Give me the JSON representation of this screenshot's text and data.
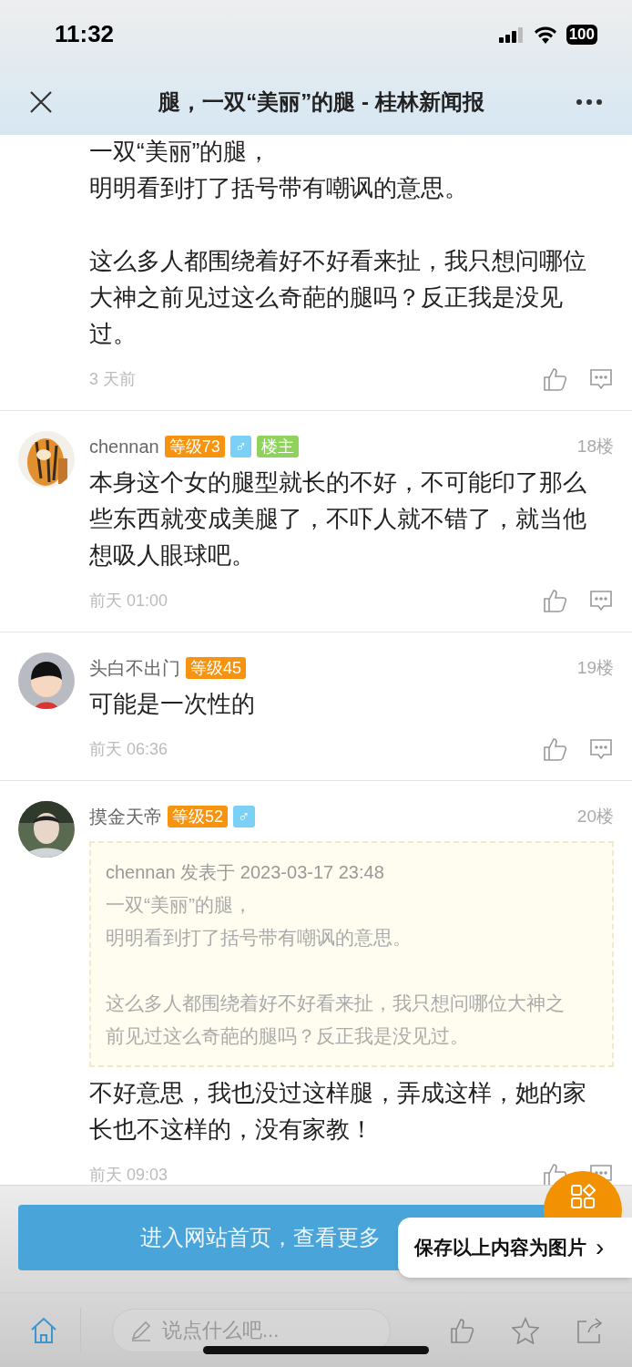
{
  "status_bar": {
    "time": "11:32",
    "battery": "100"
  },
  "header": {
    "title": "腿，一双“美丽”的腿 - 桂林新闻报"
  },
  "posts": [
    {
      "paragraphs": [
        [
          "一双“美丽”的腿，",
          "明明看到打了括号带有嘲讽的意思。"
        ],
        [
          "这么多人都围绕着好不好看来扯，我只想问哪位大神之前见过这么奇葩的腿吗？反正我是没见过。"
        ]
      ],
      "time": "3 天前"
    },
    {
      "author": "chennan",
      "avatar": {
        "kind": "picture"
      },
      "badges": [
        {
          "kind": "level",
          "text": "等级73"
        },
        {
          "kind": "gender",
          "text": "♂"
        },
        {
          "kind": "owner",
          "text": "楼主"
        }
      ],
      "floor": "18楼",
      "paragraphs": [
        [
          "本身这个女的腿型就长的不好，不可能印了那么些东西就变成美腿了，不吓人就不错了，就当他想吸人眼球吧。"
        ]
      ],
      "time": "前天 01:00"
    },
    {
      "author": "头白不出门",
      "avatar": {
        "kind": "picture"
      },
      "badges": [
        {
          "kind": "level",
          "text": "等级45"
        }
      ],
      "floor": "19楼",
      "paragraphs": [
        [
          "可能是一次性的"
        ]
      ],
      "time": "前天 06:36"
    },
    {
      "author": "摸金天帝",
      "avatar": {
        "kind": "picture"
      },
      "badges": [
        {
          "kind": "level",
          "text": "等级52"
        },
        {
          "kind": "gender",
          "text": "♂"
        }
      ],
      "floor": "20楼",
      "quote": {
        "header": "chennan 发表于 2023-03-17 23:48",
        "paragraphs": [
          [
            "一双“美丽”的腿，",
            "明明看到打了括号带有嘲讽的意思。"
          ],
          [
            "这么多人都围绕着好不好看来扯，我只想问哪位大神之前见过这么奇葩的腿吗？反正我是没见过。"
          ]
        ]
      },
      "paragraphs": [
        [
          "不好意思，我也没过这样腿，弄成这样，她的家长也不这样的，没有家教！"
        ]
      ],
      "time": "前天 09:03"
    }
  ],
  "footer": {
    "home_button": "进入网站首页，查看更多",
    "popup": "保存以上内容为图片",
    "popup_arrow": "›",
    "comment_input": {
      "placeholder": "说点什么吧..."
    }
  }
}
